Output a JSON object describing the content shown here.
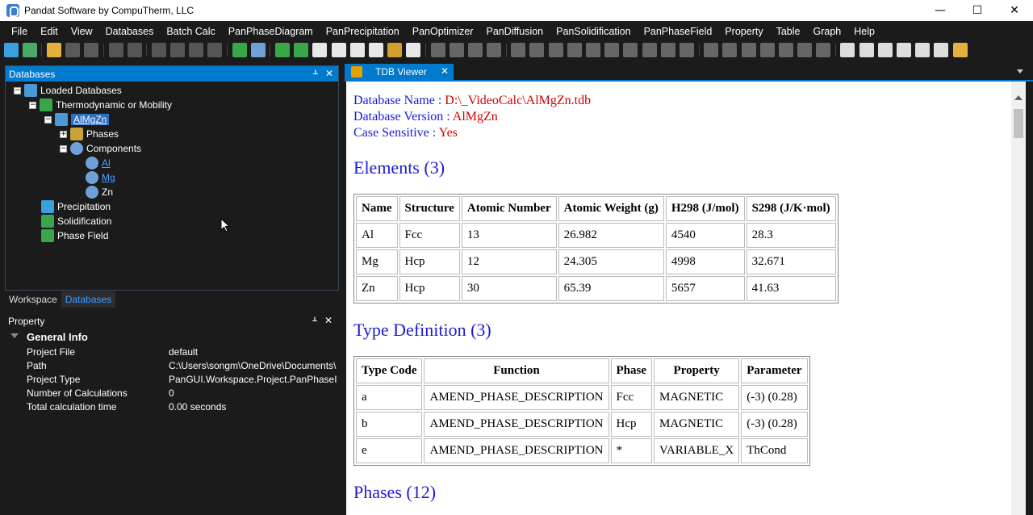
{
  "window": {
    "title": "Pandat Software by CompuTherm, LLC",
    "buttons": {
      "minimize": "—",
      "maximize": "☐",
      "close": "✕"
    }
  },
  "menu": [
    "File",
    "Edit",
    "View",
    "Databases",
    "Batch Calc",
    "PanPhaseDiagram",
    "PanPrecipitation",
    "PanOptimizer",
    "PanDiffusion",
    "PanSolidification",
    "PanPhaseField",
    "Property",
    "Table",
    "Graph",
    "Help"
  ],
  "databases_panel": {
    "title": "Databases",
    "pin": "ᚆ",
    "close": "✕",
    "tree": {
      "root": "Loaded Databases",
      "thermo": "Thermodynamic or Mobility",
      "db": "AlMgZn",
      "phases": "Phases",
      "components": "Components",
      "al": "Al",
      "mg": "Mg",
      "zn": "Zn",
      "precipitation": "Precipitation",
      "solidification": "Solidification",
      "phase_field": "Phase Field"
    }
  },
  "left_tabs": {
    "workspace": "Workspace",
    "databases": "Databases"
  },
  "property_panel": {
    "title": "Property",
    "pin": "ᚆ",
    "close": "✕",
    "group": "General Info",
    "rows": [
      {
        "key": "Project File",
        "value": "default"
      },
      {
        "key": "Path",
        "value": "C:\\Users\\songm\\OneDrive\\Documents\\"
      },
      {
        "key": "Project Type",
        "value": "PanGUI.Workspace.Project.PanPhaseI"
      },
      {
        "key": "Number of Calculations",
        "value": "0"
      },
      {
        "key": "Total calculation time",
        "value": "0.00 seconds"
      }
    ]
  },
  "doc_tab": {
    "label": "TDB Viewer",
    "close": "✕"
  },
  "tdb": {
    "db_name_label": "Database Name : ",
    "db_name": "D:\\_VideoCalc\\AlMgZn.tdb",
    "db_version_label": "Database Version : ",
    "db_version": "AlMgZn",
    "case_label": "Case Sensitive : ",
    "case_value": "Yes",
    "elements_heading": "Elements (3)",
    "elements_headers": [
      "Name",
      "Structure",
      "Atomic Number",
      "Atomic Weight (g)",
      "H298 (J/mol)",
      "S298 (J/K·mol)"
    ],
    "elements_rows": [
      [
        "Al",
        "Fcc",
        "13",
        "26.982",
        "4540",
        "28.3"
      ],
      [
        "Mg",
        "Hcp",
        "12",
        "24.305",
        "4998",
        "32.671"
      ],
      [
        "Zn",
        "Hcp",
        "30",
        "65.39",
        "5657",
        "41.63"
      ]
    ],
    "type_heading": "Type Definition (3)",
    "type_headers": [
      "Type Code",
      "Function",
      "Phase",
      "Property",
      "Parameter"
    ],
    "type_rows": [
      [
        "a",
        "AMEND_PHASE_DESCRIPTION",
        "Fcc",
        "MAGNETIC",
        "(-3) (0.28)"
      ],
      [
        "b",
        "AMEND_PHASE_DESCRIPTION",
        "Hcp",
        "MAGNETIC",
        "(-3) (0.28)"
      ],
      [
        "e",
        "AMEND_PHASE_DESCRIPTION",
        "*",
        "VARIABLE_X",
        "ThCond"
      ]
    ],
    "phases_heading": "Phases (12)"
  },
  "colors": {
    "accent": "#007acc",
    "background": "#1b1b1c",
    "link_blue": "#1a1ad6",
    "value_red": "#d10000"
  }
}
